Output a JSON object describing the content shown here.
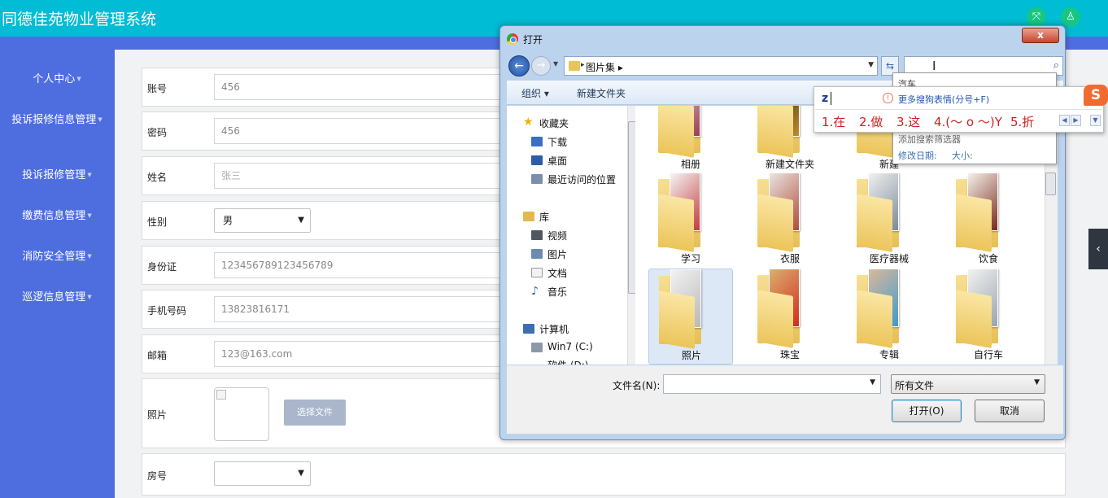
{
  "app": {
    "title": "同德佳苑物业管理系统"
  },
  "sidebar": {
    "items": [
      {
        "label": "个人中心"
      },
      {
        "label": "投诉报修信息管理"
      },
      {
        "label": "投诉报修管理"
      },
      {
        "label": "缴费信息管理"
      },
      {
        "label": "消防安全管理"
      },
      {
        "label": "巡逻信息管理"
      }
    ]
  },
  "form": {
    "account_label": "账号",
    "account_value": "456",
    "password_label": "密码",
    "password_value": "456",
    "name_label": "姓名",
    "name_placeholder": "张三",
    "gender_label": "性别",
    "gender_value": "男",
    "id_label": "身份证",
    "id_value": "123456789123456789",
    "phone_label": "手机号码",
    "phone_value": "13823816171",
    "email_label": "邮箱",
    "email_value": "123@163.com",
    "photo_label": "照片",
    "choose_file": "选择文件",
    "room_label": "房号",
    "room_value": ""
  },
  "dialog": {
    "title": "打开",
    "close": "x",
    "path_crumb": "图片集",
    "search_value": "",
    "toolbar": {
      "organize": "组织",
      "new_folder": "新建文件夹"
    },
    "nav": {
      "favorites": "收藏夹",
      "downloads": "下载",
      "desktop": "桌面",
      "recent": "最近访问的位置",
      "libraries": "库",
      "videos": "视频",
      "pictures": "图片",
      "documents": "文档",
      "music": "音乐",
      "computer": "计算机",
      "win7c": "Win7 (C:)",
      "partial": "软件 (D:)"
    },
    "folders": [
      {
        "name": "相册"
      },
      {
        "name": "新建文件夹"
      },
      {
        "name": "新建"
      },
      {
        "name": "学习"
      },
      {
        "name": "衣服"
      },
      {
        "name": "医疗器械"
      },
      {
        "name": "饮食"
      },
      {
        "name": "照片"
      },
      {
        "name": "珠宝"
      },
      {
        "name": "专辑"
      },
      {
        "name": "自行车"
      }
    ],
    "filename_label": "文件名(N):",
    "filename_value": "",
    "filter_value": "所有文件",
    "open_button": "打开(O)",
    "cancel_button": "取消"
  },
  "search_suggest": {
    "history": "汽车",
    "add_filter": "添加搜索筛选器",
    "modified": "修改日期:",
    "size": "大小:"
  },
  "ime": {
    "composition": "z",
    "hint": "更多搜狗表情(分号+F)",
    "candidates": [
      "1.在",
      "2.做",
      "3.这",
      "4.(～ o ～)Y",
      "5.折"
    ],
    "logo": "S"
  },
  "colors": {
    "topbar": "#00bcd4",
    "sidebar": "#4e6ee0",
    "content_bg": "#f1f2f4",
    "ime_candidate": "#cc2222"
  },
  "icons": {
    "fullscreen": "fullscreen-icon",
    "user": "user-icon",
    "collapse": "chevron-left-icon"
  }
}
